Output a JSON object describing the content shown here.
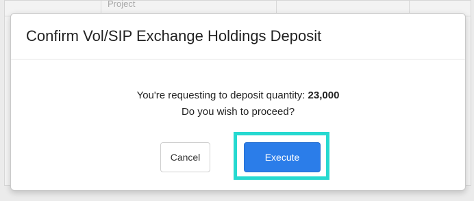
{
  "background": {
    "column_header": "Project"
  },
  "modal": {
    "title": "Confirm Vol/SIP Exchange Holdings Deposit",
    "message_prefix": "You're requesting to deposit quantity: ",
    "quantity": "23,000",
    "message_line2": "Do you wish to proceed?"
  },
  "buttons": {
    "cancel_label": "Cancel",
    "execute_label": "Execute"
  },
  "colors": {
    "primary": "#2b7de9",
    "highlight": "#26d9d0"
  }
}
